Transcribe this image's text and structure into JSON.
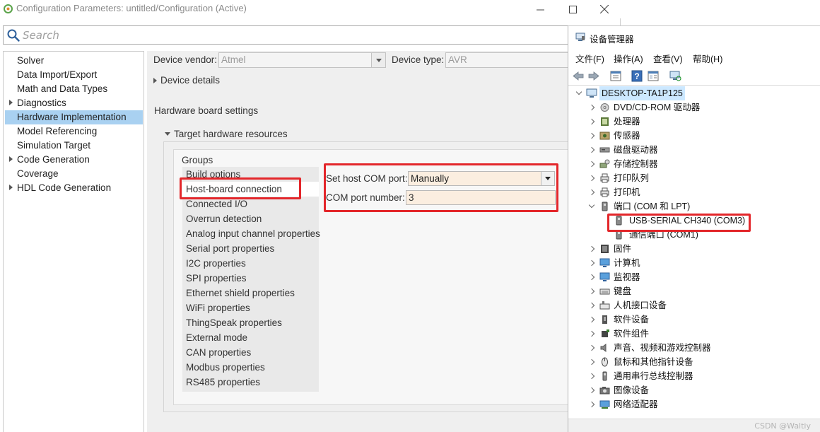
{
  "config_window": {
    "title": "Configuration Parameters: untitled/Configuration (Active)",
    "search_placeholder": "Search",
    "nav_items": [
      {
        "label": "Solver",
        "expandable": false,
        "selected": false
      },
      {
        "label": "Data Import/Export",
        "expandable": false,
        "selected": false
      },
      {
        "label": "Math and Data Types",
        "expandable": false,
        "selected": false
      },
      {
        "label": "Diagnostics",
        "expandable": true,
        "selected": false
      },
      {
        "label": "Hardware Implementation",
        "expandable": false,
        "selected": true
      },
      {
        "label": "Model Referencing",
        "expandable": false,
        "selected": false
      },
      {
        "label": "Simulation Target",
        "expandable": false,
        "selected": false
      },
      {
        "label": "Code Generation",
        "expandable": true,
        "selected": false
      },
      {
        "label": "Coverage",
        "expandable": false,
        "selected": false
      },
      {
        "label": "HDL Code Generation",
        "expandable": true,
        "selected": false
      }
    ],
    "device_vendor_label": "Device vendor:",
    "device_vendor_value": "Atmel",
    "device_type_label": "Device type:",
    "device_type_value": "AVR",
    "device_details_label": "Device details",
    "hardware_board_settings_label": "Hardware board settings",
    "target_hw_resources_label": "Target hardware resources",
    "groups_label": "Groups",
    "groups": [
      {
        "label": "Build options",
        "selected": false
      },
      {
        "label": "Host-board connection",
        "selected": true
      },
      {
        "label": "Connected I/O",
        "selected": false
      },
      {
        "label": "Overrun detection",
        "selected": false
      },
      {
        "label": "Analog input channel properties",
        "selected": false
      },
      {
        "label": "Serial port properties",
        "selected": false
      },
      {
        "label": "I2C properties",
        "selected": false
      },
      {
        "label": "SPI properties",
        "selected": false
      },
      {
        "label": "Ethernet shield properties",
        "selected": false
      },
      {
        "label": "WiFi properties",
        "selected": false
      },
      {
        "label": "ThingSpeak properties",
        "selected": false
      },
      {
        "label": "External mode",
        "selected": false
      },
      {
        "label": "CAN properties",
        "selected": false
      },
      {
        "label": "Modbus properties",
        "selected": false
      },
      {
        "label": "RS485 properties",
        "selected": false
      }
    ],
    "set_host_com_port_label": "Set host COM port:",
    "set_host_com_port_value": "Manually",
    "com_port_number_label": "COM port number:",
    "com_port_number_value": "3"
  },
  "device_manager": {
    "title": "设备管理器",
    "menus": [
      "文件(F)",
      "操作(A)",
      "查看(V)",
      "帮助(H)"
    ],
    "root": "DESKTOP-TA1P125",
    "tree": [
      {
        "label": "DVD/CD-ROM 驱动器",
        "icon": "dvd-icon",
        "expanded": false,
        "child": false
      },
      {
        "label": "处理器",
        "icon": "processor-icon",
        "expanded": false,
        "child": false
      },
      {
        "label": "传感器",
        "icon": "sensor-icon",
        "expanded": false,
        "child": false
      },
      {
        "label": "磁盘驱动器",
        "icon": "disk-drive-icon",
        "expanded": false,
        "child": false
      },
      {
        "label": "存储控制器",
        "icon": "storage-controller-icon",
        "expanded": false,
        "child": false
      },
      {
        "label": "打印队列",
        "icon": "print-queue-icon",
        "expanded": false,
        "child": false
      },
      {
        "label": "打印机",
        "icon": "printer-icon",
        "expanded": false,
        "child": false
      },
      {
        "label": "端口 (COM 和 LPT)",
        "icon": "port-icon",
        "expanded": true,
        "child": false
      },
      {
        "label": "USB-SERIAL CH340 (COM3)",
        "icon": "port-icon",
        "expanded": false,
        "child": true
      },
      {
        "label": "通信端口 (COM1)",
        "icon": "port-icon",
        "expanded": false,
        "child": true
      },
      {
        "label": "固件",
        "icon": "firmware-icon",
        "expanded": false,
        "child": false
      },
      {
        "label": "计算机",
        "icon": "computer-icon",
        "expanded": false,
        "child": false
      },
      {
        "label": "监视器",
        "icon": "monitor-icon",
        "expanded": false,
        "child": false
      },
      {
        "label": "键盘",
        "icon": "keyboard-icon",
        "expanded": false,
        "child": false
      },
      {
        "label": "人机接口设备",
        "icon": "hid-icon",
        "expanded": false,
        "child": false
      },
      {
        "label": "软件设备",
        "icon": "software-device-icon",
        "expanded": false,
        "child": false
      },
      {
        "label": "软件组件",
        "icon": "software-component-icon",
        "expanded": false,
        "child": false
      },
      {
        "label": "声音、视频和游戏控制器",
        "icon": "sound-icon",
        "expanded": false,
        "child": false
      },
      {
        "label": "鼠标和其他指针设备",
        "icon": "mouse-icon",
        "expanded": false,
        "child": false
      },
      {
        "label": "通用串行总线控制器",
        "icon": "usb-icon",
        "expanded": false,
        "child": false
      },
      {
        "label": "图像设备",
        "icon": "camera-icon",
        "expanded": false,
        "child": false
      },
      {
        "label": "网络适配器",
        "icon": "network-icon",
        "expanded": false,
        "child": false
      }
    ]
  },
  "watermark": "CSDN @Waltiy",
  "colors": {
    "selection_blue": "#a9d1f1",
    "highlight_red": "#e3262a",
    "input_fill": "#fbeee0"
  }
}
